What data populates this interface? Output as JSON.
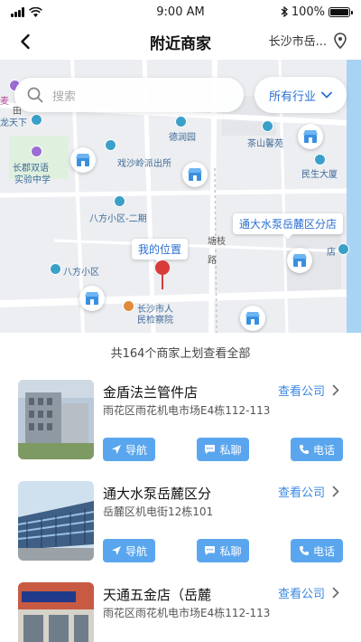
{
  "status_bar": {
    "time": "9:00 AM",
    "battery": "100%",
    "battery_level": 1.0
  },
  "nav": {
    "title": "附近商家",
    "city": "长沙市岳..."
  },
  "search": {
    "placeholder": "搜索"
  },
  "industry_filter": {
    "label": "所有行业"
  },
  "map": {
    "my_location_label": "我的位置",
    "highlight_label": "通大水泵岳麓区分店",
    "labels": [
      "麦",
      "田",
      "龙天下",
      "德润园",
      "茶山馨苑",
      "长郡双语",
      "实验中学",
      "戏沙岭派出所",
      "民生大厦",
      "八方小区-二期",
      "塘枝",
      "路",
      "八方小区",
      "长沙市人",
      "民检察院",
      "店"
    ]
  },
  "list": {
    "count_text": "共164个商家上划查看全部",
    "view_company_label": "查看公司",
    "actions": {
      "navigate": "导航",
      "chat": "私聊",
      "call": "电话"
    },
    "shops": [
      {
        "name": "金盾法兰管件店",
        "address": "雨花区雨花机电市场E4栋112-113"
      },
      {
        "name": "通大水泵岳麓区分",
        "address": "岳麓区机电街12栋101"
      },
      {
        "name": "天通五金店（岳麓",
        "address": "雨花区雨花机电市场E4栋112-113"
      }
    ]
  },
  "colors": {
    "accent": "#3a87e0",
    "button": "#5aa6ee",
    "pin": "#d93a3a"
  },
  "icons": [
    "back-arrow-icon",
    "location-pin-icon",
    "search-icon",
    "chevron-down-icon",
    "chevron-right-icon",
    "navigate-arrow-icon",
    "chat-icon",
    "phone-icon",
    "store-icon"
  ]
}
